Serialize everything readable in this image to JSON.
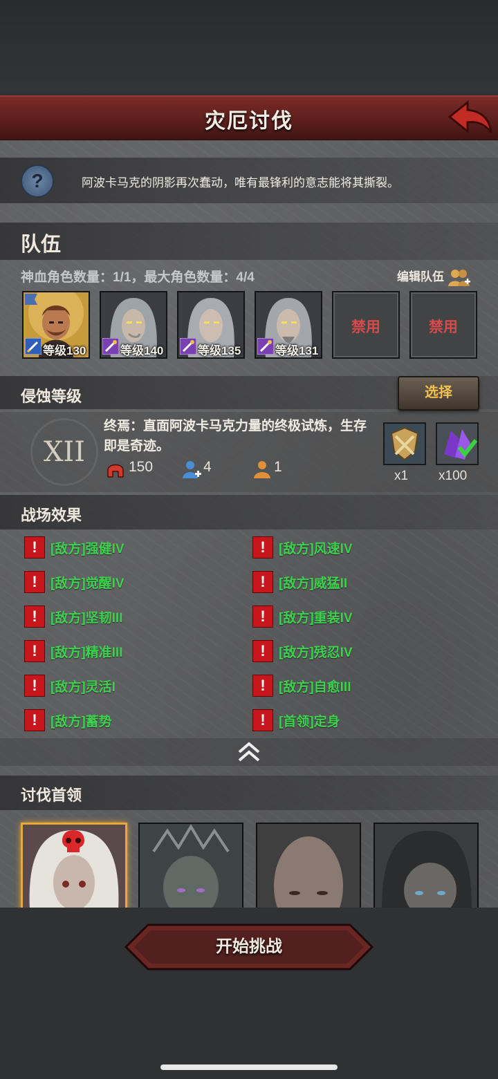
{
  "header": {
    "title": "灾厄讨伐"
  },
  "help": {
    "text": "阿波卡马克的阴影再次蠢动，唯有最锋利的意志能将其撕裂。"
  },
  "team": {
    "title": "队伍",
    "counts": "神血角色数量：1/1，最大角色数量：4/4",
    "edit_label": "编辑队伍",
    "members": [
      {
        "level": "等级130"
      },
      {
        "level": "等级140"
      },
      {
        "level": "等级135"
      },
      {
        "level": "等级131"
      }
    ],
    "banned_label": "禁用"
  },
  "corrosion": {
    "title": "侵蚀等级",
    "select_label": "选择",
    "level_numeral": "XII",
    "description": "终焉：直面阿波卡马克力量的终极试炼，生存即是奇迹。",
    "stats": {
      "attack": "150",
      "players": "4",
      "revives": "1"
    },
    "rewards": [
      {
        "count": "x1"
      },
      {
        "count": "x100"
      }
    ]
  },
  "battlefield": {
    "title": "战场效果",
    "left": [
      "[敌方]强健IV",
      "[敌方]觉醒IV",
      "[敌方]坚韧III",
      "[敌方]精准III",
      "[敌方]灵活I",
      "[敌方]蓄势"
    ],
    "right": [
      "[敌方]风速IV",
      "[敌方]威猛II",
      "[敌方]重装IV",
      "[敌方]残忍IV",
      "[敌方]自愈III",
      "[首领]定身"
    ]
  },
  "boss": {
    "title": "讨伐首领"
  },
  "footer": {
    "start_label": "开始挑战"
  },
  "colors": {
    "accent_red": "#7a2b27",
    "effect_green": "#3fd050",
    "select_gold": "#f0c050"
  }
}
